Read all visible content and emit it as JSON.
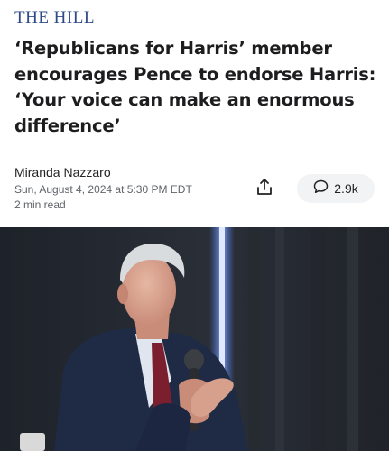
{
  "publisher": "THE HILL",
  "headline": "‘Republicans for Harris’ member encourages Pence to endorse Harris: ‘Your voice can make an enormous difference’",
  "author": "Miranda Nazzaro",
  "date": "Sun, August 4, 2024 at 5:30 PM EDT",
  "read_time": "2 min read",
  "comments_count": "2.9k",
  "icons": {
    "share": "share-icon",
    "comment": "comment-icon"
  },
  "colors": {
    "publisher": "#2e4a86",
    "pill_bg": "#f1f3f5"
  }
}
